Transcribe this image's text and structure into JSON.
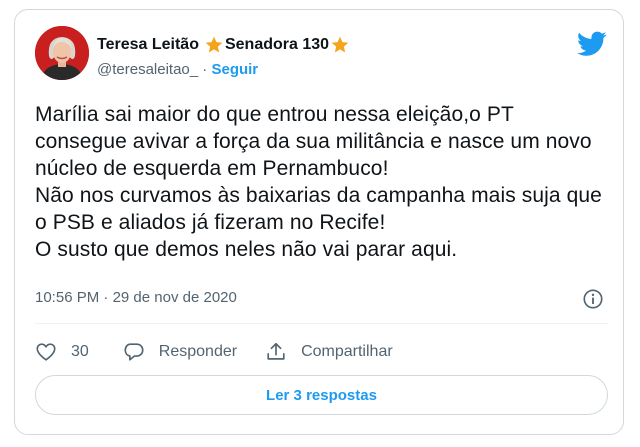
{
  "author": {
    "name": "Teresa Leitão",
    "title": "Senadora 130",
    "handle": "@teresaleitao_",
    "separator": "·",
    "follow_label": "Seguir"
  },
  "tweet": {
    "text": "Marília sai maior do que entrou nessa eleição,o PT consegue avivar a força da sua militância e nasce um novo núcleo de esquerda em Pernambuco!\nNão nos curvamos às baixarias da campanha mais suja que o PSB e aliados já fizeram no Recife!\nO susto que demos neles não vai parar aqui.",
    "time": "10:56 PM",
    "date": "29 de nov de 2020"
  },
  "actions": {
    "like_count": "30",
    "reply_label": "Responder",
    "share_label": "Compartilhar"
  },
  "read_replies_label": "Ler 3 respostas",
  "colors": {
    "accent": "#1d9bf0",
    "star": "#f4a51c",
    "text": "#0f1419",
    "muted": "#536471",
    "avatar_bg": "#c9201f"
  },
  "icons": [
    "twitter-bird-icon",
    "star-icon",
    "info-icon",
    "heart-icon",
    "reply-icon",
    "share-icon"
  ]
}
